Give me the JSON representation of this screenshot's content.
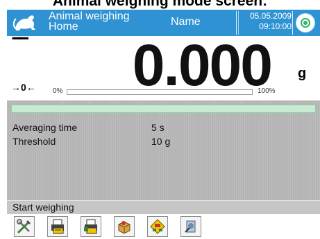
{
  "page_heading": "Animal weighing mode screen:",
  "header": {
    "mode_line1": "Animal weighing",
    "mode_line2": "Home",
    "user": "Name",
    "date": "05.05.2009",
    "time": "09:10:00",
    "background_color": "#2f93d3"
  },
  "display": {
    "stability_symbol": "▔▔",
    "zero_indicator": "→0←",
    "weight": "0.000",
    "unit": "g",
    "bar_min": "0%",
    "bar_max": "100%",
    "bar_level": 0
  },
  "info": {
    "progress_level": 1,
    "params": [
      {
        "label": "Averaging time",
        "value": "5 s"
      },
      {
        "label": "Threshold",
        "value": "10 g"
      }
    ]
  },
  "function_label": "Start weighing",
  "toolbar": {
    "buttons": [
      {
        "icon": "settings-tools-icon"
      },
      {
        "icon": "label-print-icon"
      },
      {
        "icon": "report-print-icon"
      },
      {
        "icon": "product-weighing-icon"
      },
      {
        "icon": "database-icon"
      },
      {
        "icon": "statistics-icon"
      }
    ]
  }
}
